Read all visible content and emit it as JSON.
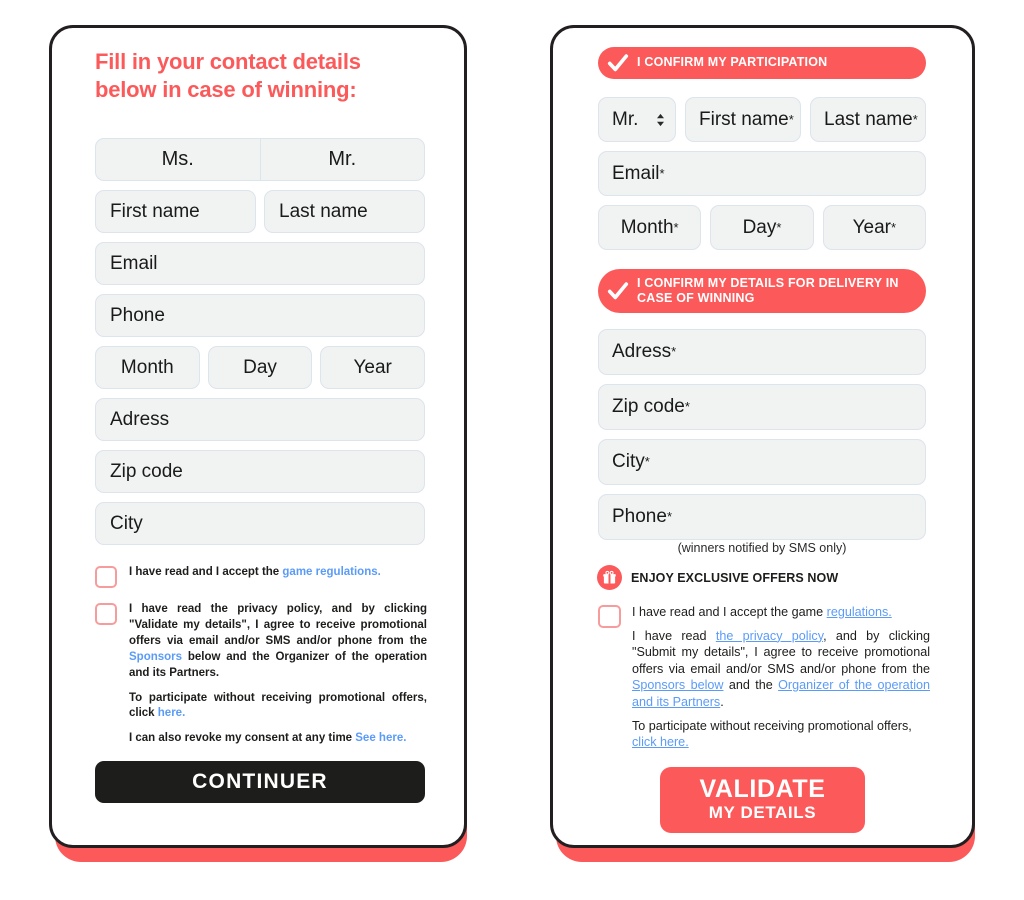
{
  "left_panel": {
    "title": "Fill in your contact details below in case of winning:",
    "salutation": {
      "options": [
        "Ms.",
        "Mr."
      ]
    },
    "fields": {
      "first_name": "First name",
      "last_name": "Last name",
      "email": "Email",
      "phone": "Phone",
      "month": "Month",
      "day": "Day",
      "year": "Year",
      "address": "Adress",
      "zip": "Zip code",
      "city": "City"
    },
    "consent": {
      "line1_a": "I have read and I accept the ",
      "line1_link": "game regulations.",
      "line2_a": "I have read the privacy policy, and by clicking \"Validate my details\", I agree to receive promotional offers via email and/or SMS and/or phone from the ",
      "line2_link": "Sponsors",
      "line2_b": " below and the Organizer of the operation and its Partners.",
      "line3_a": "To participate without receiving promotional offers, click ",
      "line3_link": "here.",
      "line4_a": "I can also revoke my consent at any time ",
      "line4_link": "See here."
    },
    "continue_button": "CONTINUER"
  },
  "right_panel": {
    "banner_participation": "I CONFIRM MY PARTICIPATION",
    "banner_delivery": "I CONFIRM MY DETAILS FOR DELIVERY IN CASE OF WINNING",
    "salutation_selected": "Mr.",
    "fields": {
      "first_name": "First name",
      "last_name": "Last name",
      "email": "Email",
      "month": "Month",
      "day": "Day",
      "year": "Year",
      "address": "Adress",
      "zip": "Zip code",
      "city": "City",
      "phone": "Phone",
      "required_marker": "*"
    },
    "sms_note": "(winners notified by SMS only)",
    "offers_label": "ENJOY EXCLUSIVE OFFERS NOW",
    "consent": {
      "line1_a": "I have read and I accept the game ",
      "line1_link": "regulations.",
      "line2_a": "I have read ",
      "line2_link1": "the privacy policy",
      "line2_b": ", and by clicking \"Submit my details\", I agree to receive promotional offers via email and/or SMS and/or phone from the ",
      "line2_link2": "Sponsors below",
      "line2_c": " and the ",
      "line2_link3": "Organizer of the operation and its Partners",
      "line2_d": ".",
      "line3_a": "To participate without receiving promotional offers, ",
      "line3_link": "click here."
    },
    "validate_button_line1": "VALIDATE",
    "validate_button_line2": "MY DETAILS"
  },
  "colors": {
    "accent_red": "#FC5A5A",
    "field_bg": "#F1F2F2",
    "field_border": "#DCE4EC",
    "link_blue": "#5B9BF8",
    "checkbox_border": "#F79C9C",
    "dark": "#1d1d1b"
  },
  "icons": {
    "check": "check-icon",
    "gift": "gift-icon",
    "caret": "select-caret-icon"
  }
}
